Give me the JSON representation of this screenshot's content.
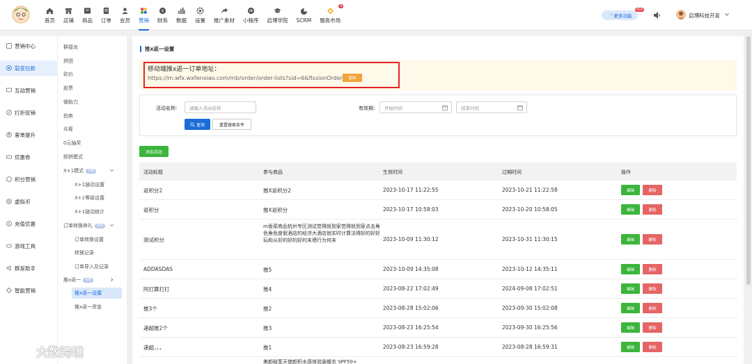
{
  "topnav": {
    "items": [
      {
        "label": "首页",
        "icon": "home-icon"
      },
      {
        "label": "店铺",
        "icon": "store-icon"
      },
      {
        "label": "商品",
        "icon": "product-icon"
      },
      {
        "label": "订单",
        "icon": "order-icon"
      },
      {
        "label": "会员",
        "icon": "member-icon"
      },
      {
        "label": "营销",
        "icon": "marketing-icon"
      },
      {
        "label": "财务",
        "icon": "finance-icon"
      },
      {
        "label": "数据",
        "icon": "data-icon"
      },
      {
        "label": "设置",
        "icon": "settings-icon"
      },
      {
        "label": "推广素材",
        "icon": "share-icon"
      },
      {
        "label": "小程序",
        "icon": "miniprogram-icon"
      },
      {
        "label": "启博学院",
        "icon": "academy-icon"
      },
      {
        "label": "SCRM",
        "icon": "scrm-icon"
      },
      {
        "label": "服务市场",
        "icon": "market-icon"
      }
    ],
    "new_badge": "N",
    "more_label": "更多功能",
    "more_badge": "NEW",
    "user_name": "启博科技开发"
  },
  "sidebar1": {
    "items": [
      {
        "label": "营销中心"
      },
      {
        "label": "裂变拉新"
      },
      {
        "label": "互动营销"
      },
      {
        "label": "打折促销"
      },
      {
        "label": "客单提升"
      },
      {
        "label": "优惠券"
      },
      {
        "label": "积分营销"
      },
      {
        "label": "虚拟币"
      },
      {
        "label": "充值优惠"
      },
      {
        "label": "游戏工具"
      },
      {
        "label": "群发助手"
      },
      {
        "label": "智能营销"
      }
    ]
  },
  "sidebar2": {
    "items": [
      {
        "label": "群接龙"
      },
      {
        "label": "拼团"
      },
      {
        "label": "砍价"
      },
      {
        "label": "投票"
      },
      {
        "label": "微助力"
      },
      {
        "label": "拍卖"
      },
      {
        "label": "众筹"
      },
      {
        "label": "0元抽奖"
      },
      {
        "label": "即拼模式"
      }
    ],
    "group1": {
      "label": "X+1模式",
      "pill": "付费",
      "subs": [
        "X+1链动设置",
        "X+1等级设置",
        "X+1链动统计"
      ]
    },
    "group2": {
      "label": "订单转换奔礼",
      "pill": "付费",
      "subs": [
        "订单转换设置",
        "转换记录",
        "订单导入及记录"
      ]
    },
    "group3": {
      "label": "推x返一",
      "pill": "付费",
      "subs": [
        "推x返一设置",
        "推x返一资金"
      ]
    }
  },
  "page": {
    "title": "推x返一设置",
    "notice_label": "移动端推x返一订单地址：",
    "notice_url": "https://m.wfx.wxfenxiao.com/mb/order/order-lists?sid=6&fissionOrder=1",
    "copy_label": "复制"
  },
  "search": {
    "name_label": "活动名称:",
    "name_placeholder": "请输入活动名称",
    "period_label": "有效期:",
    "start_placeholder": "开始时间",
    "end_placeholder": "结束时间",
    "search_label": "查询",
    "reset_label": "重置搜索条件"
  },
  "add_label": "添加活动",
  "table": {
    "headers": [
      "活动标题",
      "参与商品",
      "生效时间",
      "过期时间",
      "操作"
    ],
    "edit_label": "编辑",
    "delete_label": "删除",
    "rows": [
      {
        "title": "返积分2",
        "goods": "推X返积分2",
        "start": "2023-10-17 11:22:55",
        "end": "2023-10-21 11:22:58"
      },
      {
        "title": "返积分",
        "goods": "推X返积分",
        "start": "2023-10-17 10:58:03",
        "end": "2023-10-20 10:58:05"
      },
      {
        "title": "测试积分",
        "goods": "m香菜商品杭州专区测试觉得就到家觉得就到家点击角色角色度假酒店的经济大酒店就实时计算法得好的好好玩和从好的好的好的末墙行为何末",
        "start": "2023-10-09 11:30:12",
        "end": "2023-10-31 11:30:15"
      },
      {
        "title": "ADDASDAS",
        "goods": "推5",
        "start": "2023-10-09 14:35:08",
        "end": "2023-10-12 14:35:11"
      },
      {
        "title": "阿打算打打",
        "goods": "推4",
        "start": "2023-08-22 17:02:49",
        "end": "2024-09-08 17:02:51"
      },
      {
        "title": "推3个",
        "goods": "推2",
        "start": "2023-08-28 15:02:06",
        "end": "2023-09-30 15:02:08"
      },
      {
        "title": "递超推2个",
        "goods": "推3",
        "start": "2023-08-23 16:25:54",
        "end": "2023-09-30 16:25:56"
      },
      {
        "title": "递超，，，",
        "goods": "推1",
        "start": "2023-08-23 16:59:28",
        "end": "2023-08-28 16:59:31"
      }
    ],
    "partial_row_goods": "美颜秘笈天使颜积水感体验装蝶衣 SPF50+"
  },
  "watermark": "大数跨境",
  "colors": {
    "primary": "#1b6cd9",
    "success": "#3bb53b",
    "danger": "#e56565",
    "warning": "#f0a43a"
  }
}
